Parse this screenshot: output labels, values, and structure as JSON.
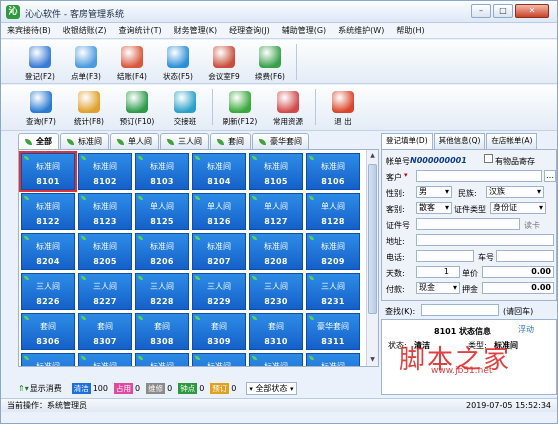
{
  "window": {
    "title": "沁心软件 - 客房管理系统",
    "logo": "沁",
    "min": "–",
    "max": "□",
    "close": "✕"
  },
  "menu": [
    "来宾接待(B)",
    "收银结账(Z)",
    "查询统计(T)",
    "财务管理(K)",
    "经理查询(J)",
    "辅助管理(G)",
    "系统维护(W)",
    "帮助(H)"
  ],
  "toolbar1": [
    {
      "label": "登记(F2)",
      "icon": "register-icon"
    },
    {
      "label": "点单(F3)",
      "icon": "order-icon"
    },
    {
      "label": "结账(F4)",
      "icon": "checkout-icon"
    },
    {
      "label": "状态(F5)",
      "icon": "status-icon"
    },
    {
      "label": "会议室F9",
      "icon": "meeting-room-icon"
    },
    {
      "label": "续费(F6)",
      "icon": "renew-fee-icon"
    }
  ],
  "toolbar2": [
    {
      "label": "查询(F7)",
      "icon": "search-icon"
    },
    {
      "label": "统计(F8)",
      "icon": "statistics-icon"
    },
    {
      "label": "预订(F10)",
      "icon": "reserve-icon"
    },
    {
      "label": "交接班",
      "icon": "shift-handover-icon"
    },
    {
      "label": "刷新(F12)",
      "icon": "refresh-icon"
    },
    {
      "label": "常用资源",
      "icon": "resources-icon"
    },
    {
      "label": "退 出",
      "icon": "exit-icon"
    }
  ],
  "room_tabs": [
    "全部",
    "标准间",
    "单人间",
    "三人间",
    "套间",
    "豪华套间"
  ],
  "rooms": [
    {
      "type": "标准间",
      "no": "8101"
    },
    {
      "type": "标准间",
      "no": "8102"
    },
    {
      "type": "标准间",
      "no": "8103"
    },
    {
      "type": "标准间",
      "no": "8104"
    },
    {
      "type": "标准间",
      "no": "8105"
    },
    {
      "type": "标准间",
      "no": "8106"
    },
    {
      "type": "标准间",
      "no": "8122"
    },
    {
      "type": "标准间",
      "no": "8123"
    },
    {
      "type": "单人间",
      "no": "8125"
    },
    {
      "type": "单人间",
      "no": "8126"
    },
    {
      "type": "单人间",
      "no": "8127"
    },
    {
      "type": "单人间",
      "no": "8128"
    },
    {
      "type": "标准间",
      "no": "8204"
    },
    {
      "type": "标准间",
      "no": "8205"
    },
    {
      "type": "标准间",
      "no": "8206"
    },
    {
      "type": "标准间",
      "no": "8207"
    },
    {
      "type": "标准间",
      "no": "8208"
    },
    {
      "type": "标准间",
      "no": "8209"
    },
    {
      "type": "三人间",
      "no": "8226"
    },
    {
      "type": "三人间",
      "no": "8227"
    },
    {
      "type": "三人间",
      "no": "8228"
    },
    {
      "type": "三人间",
      "no": "8229"
    },
    {
      "type": "三人间",
      "no": "8230"
    },
    {
      "type": "三人间",
      "no": "8231"
    },
    {
      "type": "套间",
      "no": "8306"
    },
    {
      "type": "套间",
      "no": "8307"
    },
    {
      "type": "套间",
      "no": "8308"
    },
    {
      "type": "套间",
      "no": "8309"
    },
    {
      "type": "套间",
      "no": "8310"
    },
    {
      "type": "豪华套间",
      "no": "8311"
    },
    {
      "type": "标准间",
      "no": ""
    },
    {
      "type": "标准间",
      "no": ""
    },
    {
      "type": "标准间",
      "no": ""
    },
    {
      "type": "标准间",
      "no": ""
    },
    {
      "type": "标准间",
      "no": ""
    },
    {
      "type": "标准间",
      "no": ""
    }
  ],
  "bottom": {
    "show_consume": "显示消费",
    "legend": [
      {
        "label": "清洁",
        "count": "100",
        "color": "#1d6fe0"
      },
      {
        "label": "占用",
        "count": "0",
        "color": "#e04ba0"
      },
      {
        "label": "维修",
        "count": "0",
        "color": "#8a8a8a"
      },
      {
        "label": "钟点",
        "count": "0",
        "color": "#2a9a3a"
      },
      {
        "label": "预订",
        "count": "0",
        "color": "#e0a020"
      }
    ],
    "filter": "全部状态"
  },
  "status": {
    "left": "当前操作：系统管理员",
    "right": "2019-07-05 15:52:34"
  },
  "right_tabs": [
    "登记填单(D)",
    "其他信息(Q)",
    "在店帐单(A)"
  ],
  "form": {
    "bill_no_label": "帐单号",
    "bill_no": "N000000001",
    "deposit_label": "有物品寄存",
    "guest_label": "客户",
    "gender_label": "性别:",
    "gender": "男",
    "ethnic_label": "民族:",
    "ethnic": "汉族",
    "source_label": "客别:",
    "source": "散客",
    "idtype_label": "证件类型",
    "idtype": "身份证",
    "idno_label": "证件号",
    "read_card": "读卡",
    "addr_label": "地址:",
    "phone_label": "电话:",
    "plate_label": "车号",
    "days_label": "天数:",
    "days": "1",
    "price_label": "单价",
    "price": "0.00",
    "pay_label": "付款:",
    "pay": "现金",
    "deposit2_label": "押金",
    "deposit2": "0.00"
  },
  "find": {
    "label": "查找(K):",
    "btn": "(请回车)"
  },
  "info": {
    "title": "8101 状态信息",
    "float": "浮动",
    "state_label": "状态:",
    "state": "清洁",
    "type_label": "类型:",
    "type": "标准间"
  },
  "watermark": {
    "text": "脚本之家",
    "url": "www.jb51.net"
  }
}
